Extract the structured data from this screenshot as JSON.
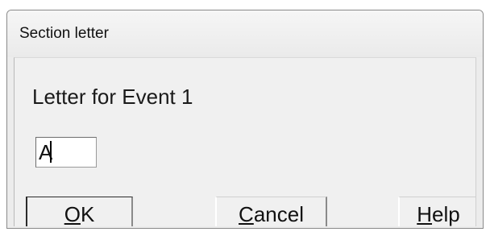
{
  "window": {
    "title": "Section letter"
  },
  "dialog": {
    "prompt": "Letter for Event 1",
    "letter_value": "A"
  },
  "buttons": {
    "ok": {
      "mnemonic": "O",
      "rest": "K"
    },
    "cancel": {
      "mnemonic": "C",
      "rest": "ancel"
    },
    "help": {
      "mnemonic": "H",
      "rest": "elp"
    }
  }
}
